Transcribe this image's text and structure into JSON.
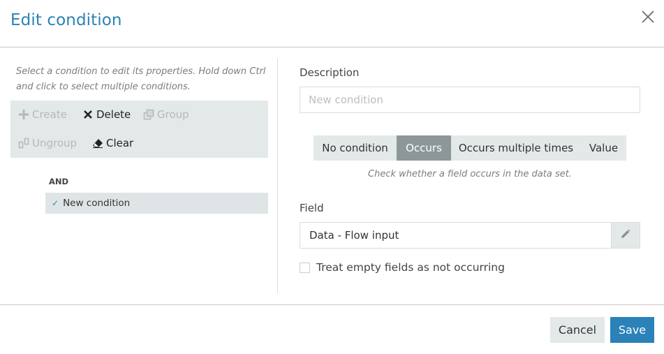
{
  "dialog": {
    "title": "Edit condition"
  },
  "left": {
    "hint": "Select a condition to edit its properties. Hold down Ctrl and click to select multiple conditions.",
    "toolbar": {
      "create": "Create",
      "delete": "Delete",
      "group": "Group",
      "ungroup": "Ungroup",
      "clear": "Clear"
    },
    "tree": {
      "operator": "AND",
      "items": [
        {
          "label": "New condition",
          "selected": true
        }
      ]
    }
  },
  "right": {
    "description_label": "Description",
    "description_value": "",
    "description_placeholder": "New condition",
    "condition_types": [
      "No condition",
      "Occurs",
      "Occurs multiple times",
      "Value"
    ],
    "selected_type": "Occurs",
    "type_hint": "Check whether a field occurs in the data set.",
    "field_label": "Field",
    "field_value": "Data - Flow input",
    "checkbox_label": "Treat empty fields as not occurring",
    "checkbox_checked": false
  },
  "footer": {
    "cancel": "Cancel",
    "save": "Save"
  },
  "colors": {
    "accent": "#2a82b8",
    "panel": "#e3e9e9",
    "selected_segment": "#8d9699"
  }
}
